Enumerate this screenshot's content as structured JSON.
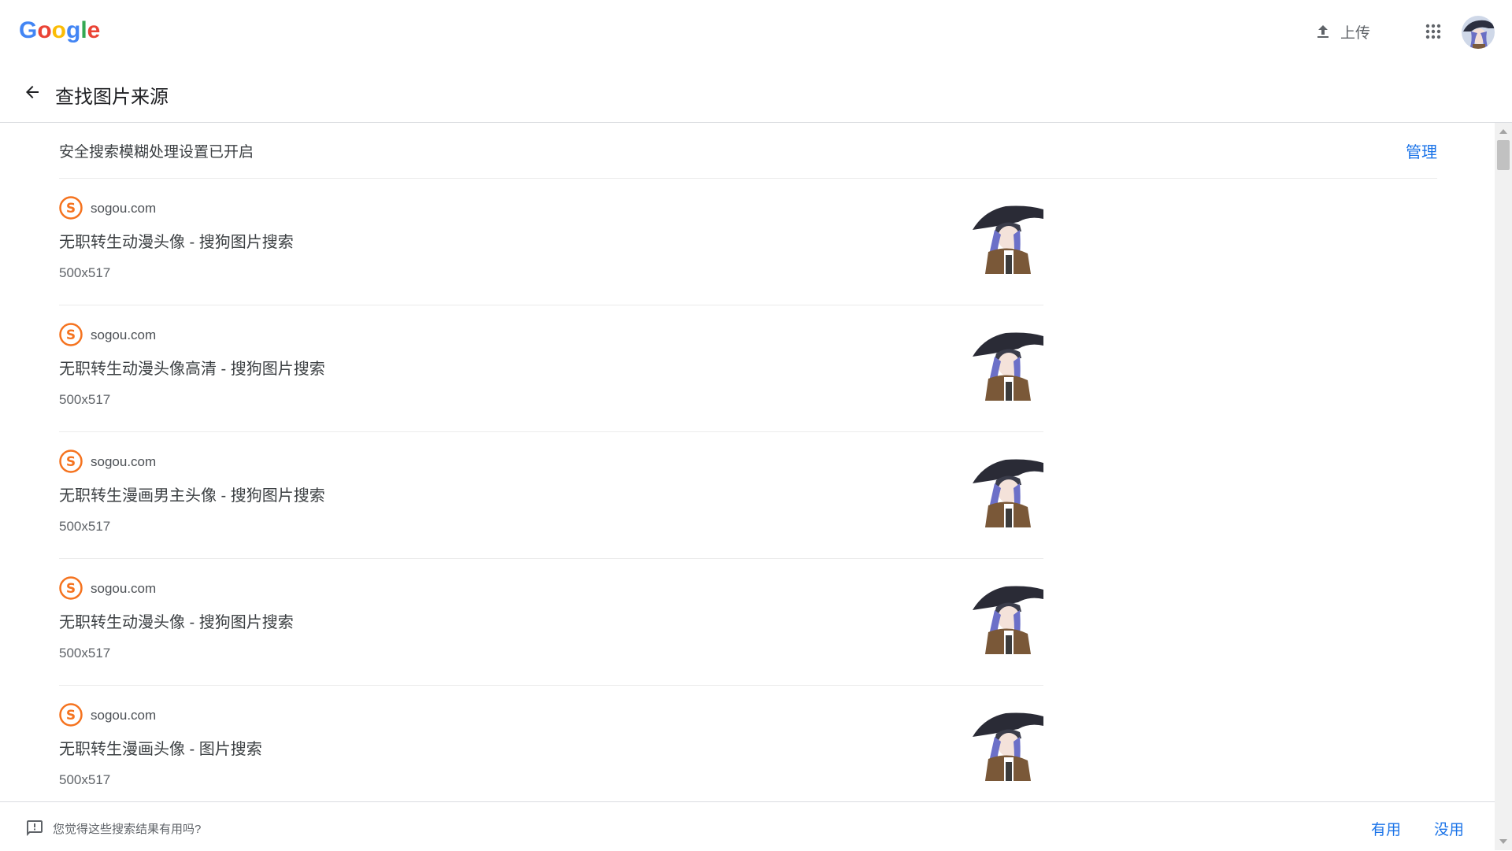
{
  "header": {
    "logo_letters": [
      "G",
      "o",
      "o",
      "g",
      "l",
      "e"
    ],
    "logo_colors": [
      "#4285f4",
      "#ea4335",
      "#fbbc05",
      "#4285f4",
      "#34a853",
      "#ea4335"
    ],
    "upload_label": "上传",
    "apps_icon": "apps-grid-icon",
    "avatar_icon": "user-avatar"
  },
  "subheader": {
    "back_icon": "arrow-left-icon",
    "title": "查找图片来源"
  },
  "safe_search": {
    "text": "安全搜索模糊处理设置已开启",
    "manage_label": "管理"
  },
  "results": [
    {
      "site": "sogou.com",
      "title": "无职转生动漫头像 - 搜狗图片搜索",
      "size": "500x517"
    },
    {
      "site": "sogou.com",
      "title": "无职转生动漫头像高清 - 搜狗图片搜索",
      "size": "500x517"
    },
    {
      "site": "sogou.com",
      "title": "无职转生漫画男主头像 - 搜狗图片搜索",
      "size": "500x517"
    },
    {
      "site": "sogou.com",
      "title": "无职转生动漫头像 - 搜狗图片搜索",
      "size": "500x517"
    },
    {
      "site": "sogou.com",
      "title": "无职转生漫画头像 - 图片搜索",
      "size": "500x517"
    }
  ],
  "feedback": {
    "icon": "feedback-icon",
    "question": "您觉得这些搜索结果有用吗?",
    "yes_label": "有用",
    "no_label": "没用"
  },
  "colors": {
    "link_blue": "#1a73e8",
    "sogou_orange": "#f5731f",
    "divider": "#dadce0"
  }
}
